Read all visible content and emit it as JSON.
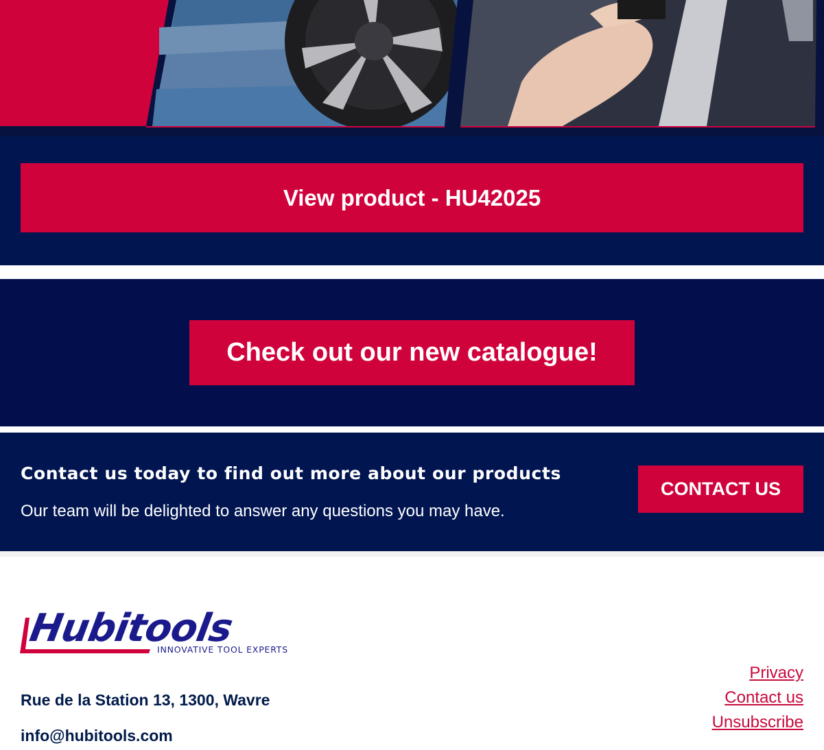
{
  "colors": {
    "brand_red": "#d0023c",
    "navy": "#011551",
    "deep_navy": "#020f4c",
    "link_red": "#c8093a",
    "text_navy": "#001a4a"
  },
  "hero": {
    "image_left": "wheel-on-lift-photo",
    "image_right": "hand-holding-tool-photo"
  },
  "product_cta": {
    "label": "View product - HU42025"
  },
  "catalogue_cta": {
    "label": "Check out our new catalogue!"
  },
  "contact": {
    "heading": "Contact us today to find out more about our products",
    "subtext": "Our team will be delighted to answer any questions you may have.",
    "button_label": "CONTACT US"
  },
  "footer": {
    "logo": {
      "brand": "Hubitools",
      "tagline": "INNOVATIVE TOOL EXPERTS"
    },
    "address": "Rue de la Station 13, 1300, Wavre",
    "email": "info@hubitools.com",
    "links": [
      "Privacy",
      "Contact us",
      "Unsubscribe"
    ]
  }
}
